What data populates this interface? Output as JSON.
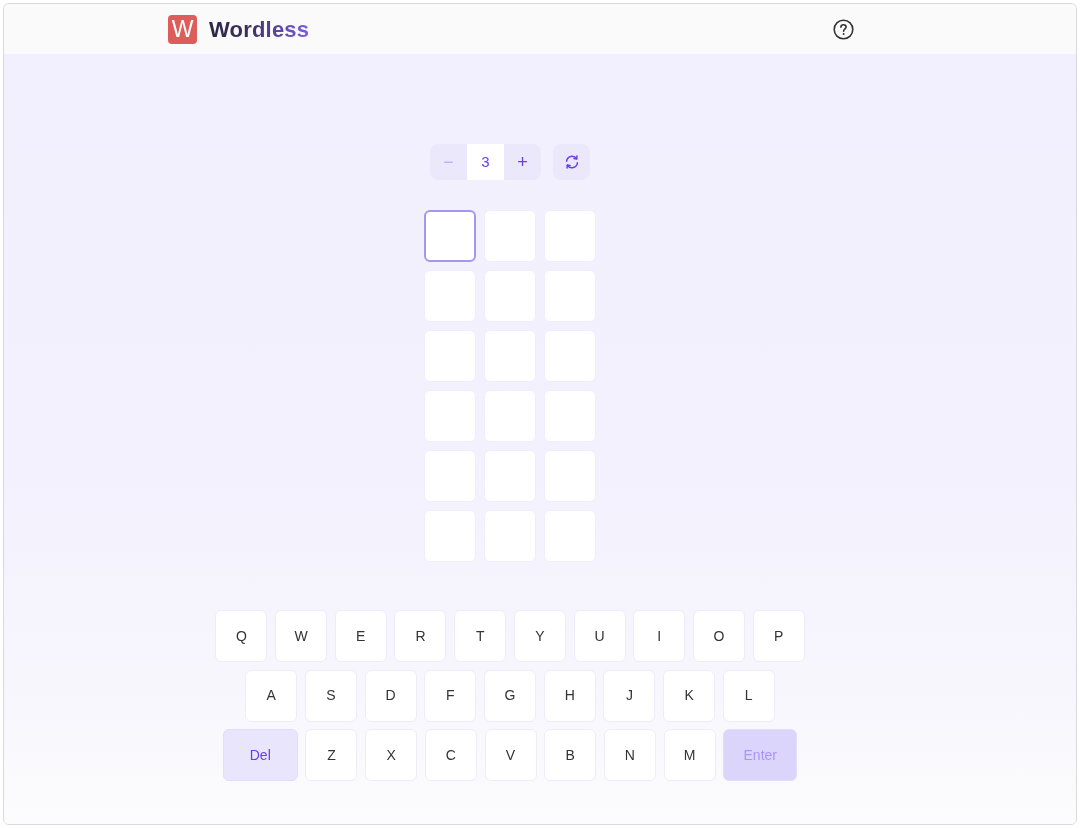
{
  "header": {
    "logo_letter": "W",
    "title": "Wordless"
  },
  "stepper": {
    "minus": {
      "label": "−",
      "disabled": true
    },
    "value": "3",
    "plus": {
      "label": "+",
      "disabled": false
    }
  },
  "grid": {
    "rows": [
      {
        "cells": [
          {
            "selected": true
          },
          {
            "selected": false
          },
          {
            "selected": false
          }
        ]
      },
      {
        "cells": [
          {
            "selected": false
          },
          {
            "selected": false
          },
          {
            "selected": false
          }
        ]
      },
      {
        "cells": [
          {
            "selected": false
          },
          {
            "selected": false
          },
          {
            "selected": false
          }
        ]
      },
      {
        "cells": [
          {
            "selected": false
          },
          {
            "selected": false
          },
          {
            "selected": false
          }
        ]
      },
      {
        "cells": [
          {
            "selected": false
          },
          {
            "selected": false
          },
          {
            "selected": false
          }
        ]
      },
      {
        "cells": [
          {
            "selected": false
          },
          {
            "selected": false
          },
          {
            "selected": false
          }
        ]
      }
    ]
  },
  "keyboard": {
    "rows": [
      {
        "keys": [
          {
            "label": "Q",
            "kind": "letter",
            "disabled": false
          },
          {
            "label": "W",
            "kind": "letter",
            "disabled": false
          },
          {
            "label": "E",
            "kind": "letter",
            "disabled": false
          },
          {
            "label": "R",
            "kind": "letter",
            "disabled": false
          },
          {
            "label": "T",
            "kind": "letter",
            "disabled": false
          },
          {
            "label": "Y",
            "kind": "letter",
            "disabled": false
          },
          {
            "label": "U",
            "kind": "letter",
            "disabled": false
          },
          {
            "label": "I",
            "kind": "letter",
            "disabled": false
          },
          {
            "label": "O",
            "kind": "letter",
            "disabled": false
          },
          {
            "label": "P",
            "kind": "letter",
            "disabled": false
          }
        ]
      },
      {
        "keys": [
          {
            "label": "A",
            "kind": "letter",
            "disabled": false
          },
          {
            "label": "S",
            "kind": "letter",
            "disabled": false
          },
          {
            "label": "D",
            "kind": "letter",
            "disabled": false
          },
          {
            "label": "F",
            "kind": "letter",
            "disabled": false
          },
          {
            "label": "G",
            "kind": "letter",
            "disabled": false
          },
          {
            "label": "H",
            "kind": "letter",
            "disabled": false
          },
          {
            "label": "J",
            "kind": "letter",
            "disabled": false
          },
          {
            "label": "K",
            "kind": "letter",
            "disabled": false
          },
          {
            "label": "L",
            "kind": "letter",
            "disabled": false
          }
        ]
      },
      {
        "keys": [
          {
            "label": "Del",
            "kind": "delete",
            "disabled": false
          },
          {
            "label": "Z",
            "kind": "letter",
            "disabled": false
          },
          {
            "label": "X",
            "kind": "letter",
            "disabled": false
          },
          {
            "label": "C",
            "kind": "letter",
            "disabled": false
          },
          {
            "label": "V",
            "kind": "letter",
            "disabled": false
          },
          {
            "label": "B",
            "kind": "letter",
            "disabled": false
          },
          {
            "label": "N",
            "kind": "letter",
            "disabled": false
          },
          {
            "label": "M",
            "kind": "letter",
            "disabled": false
          },
          {
            "label": "Enter",
            "kind": "enter",
            "disabled": true
          }
        ]
      }
    ]
  }
}
